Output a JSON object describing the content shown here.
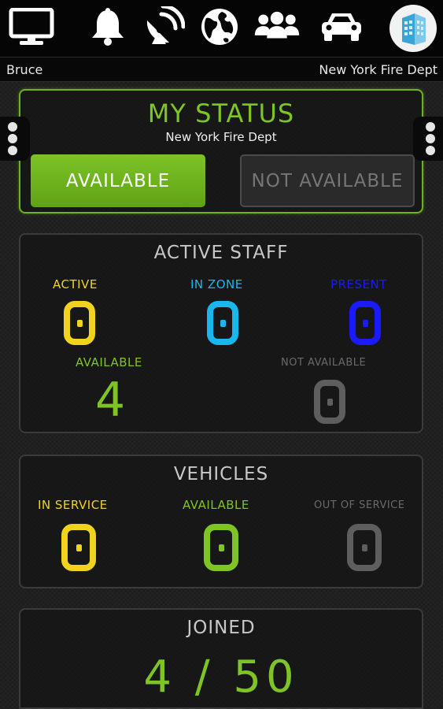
{
  "header": {
    "icons": [
      "monitor-icon",
      "bell-icon",
      "satellite-dish-icon",
      "globe-icon",
      "group-icon",
      "car-icon"
    ],
    "avatar_icon": "building-avatar-icon",
    "username": "Bruce",
    "department": "New York Fire Dept"
  },
  "my_status": {
    "title": "MY STATUS",
    "subtitle": "New York Fire Dept",
    "available_label": "AVAILABLE",
    "not_available_label": "NOT AVAILABLE",
    "selected": "AVAILABLE"
  },
  "active_staff": {
    "title": "ACTIVE STAFF",
    "active_label": "ACTIVE",
    "active_value": "0",
    "in_zone_label": "IN ZONE",
    "in_zone_value": "0",
    "present_label": "PRESENT",
    "present_value": "0",
    "available_label": "AVAILABLE",
    "available_value": "4",
    "not_available_label": "NOT AVAILABLE",
    "not_available_value": "0"
  },
  "vehicles": {
    "title": "VEHICLES",
    "in_service_label": "IN SERVICE",
    "in_service_value": "0",
    "available_label": "AVAILABLE",
    "available_value": "0",
    "out_of_service_label": "OUT OF SERVICE",
    "out_of_service_value": "0"
  },
  "joined": {
    "title": "JOINED",
    "value": "4 / 50"
  },
  "colors": {
    "green": "#7fc425",
    "yellow": "#f0d31c",
    "cyan": "#19b7ee",
    "blue": "#1a1aff",
    "gray": "#5e5e5e"
  }
}
